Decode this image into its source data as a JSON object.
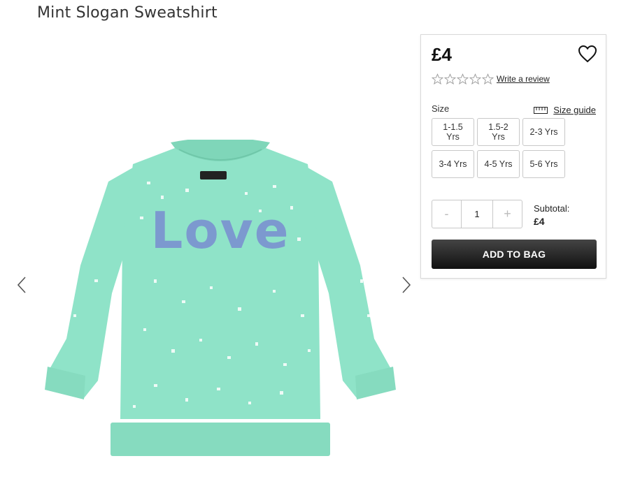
{
  "product": {
    "title": "Mint Slogan Sweatshirt",
    "price": "£4",
    "image_slogan": "Love",
    "rating": 0
  },
  "reviews": {
    "link_label": "Write a review"
  },
  "size": {
    "label": "Size",
    "guide_label": "Size guide",
    "options": [
      "1-1.5 Yrs",
      "1.5-2 Yrs",
      "2-3 Yrs",
      "3-4 Yrs",
      "4-5 Yrs",
      "5-6 Yrs"
    ]
  },
  "quantity": {
    "minus": "-",
    "value": "1",
    "plus": "+"
  },
  "subtotal": {
    "label": "Subtotal:",
    "value": "£4"
  },
  "cart": {
    "add_label": "ADD TO BAG"
  },
  "colors": {
    "sweatshirt": "#8fe3c8",
    "slogan": "#7c99cf",
    "button_dark": "#1a1a1a"
  },
  "icons": {
    "gallery_prev": "chevron-left-icon",
    "gallery_next": "chevron-right-icon",
    "wishlist": "heart-icon",
    "rating": "star-outline-icon",
    "size_guide": "ruler-icon"
  }
}
